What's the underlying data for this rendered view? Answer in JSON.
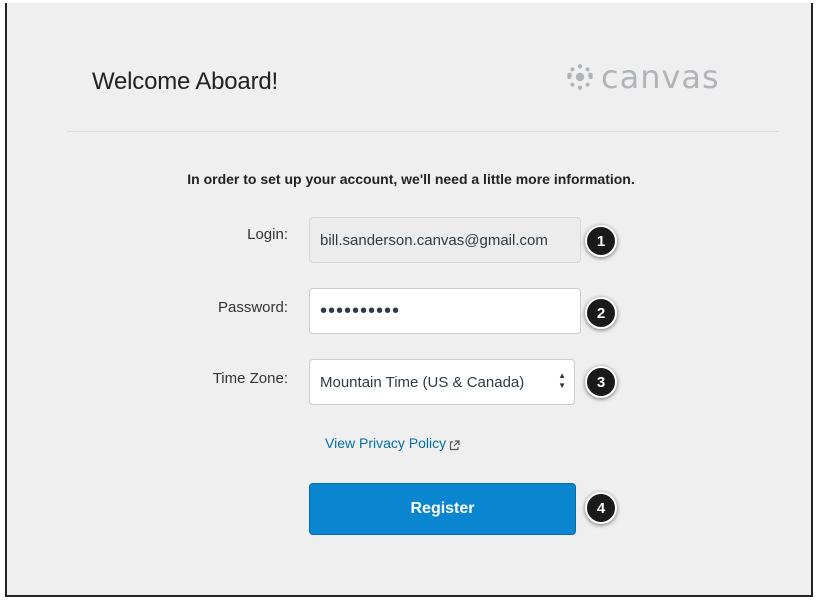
{
  "header": {
    "title": "Welcome Aboard!",
    "logo_text": "canvas",
    "logo_icon": "canvas-logo-icon"
  },
  "form": {
    "intro": "In order to set up your account, we'll need a little more information.",
    "login": {
      "label": "Login:",
      "value": "bill.sanderson.canvas@gmail.com"
    },
    "password": {
      "label": "Password:",
      "value": "••••••••••"
    },
    "timezone": {
      "label": "Time Zone:",
      "value": "Mountain Time (US & Canada)"
    },
    "privacy_link": "View Privacy Policy",
    "register_label": "Register"
  },
  "badges": [
    "1",
    "2",
    "3",
    "4"
  ],
  "colors": {
    "primary": "#0a85d0",
    "link": "#0770a3",
    "background": "#efefef"
  }
}
